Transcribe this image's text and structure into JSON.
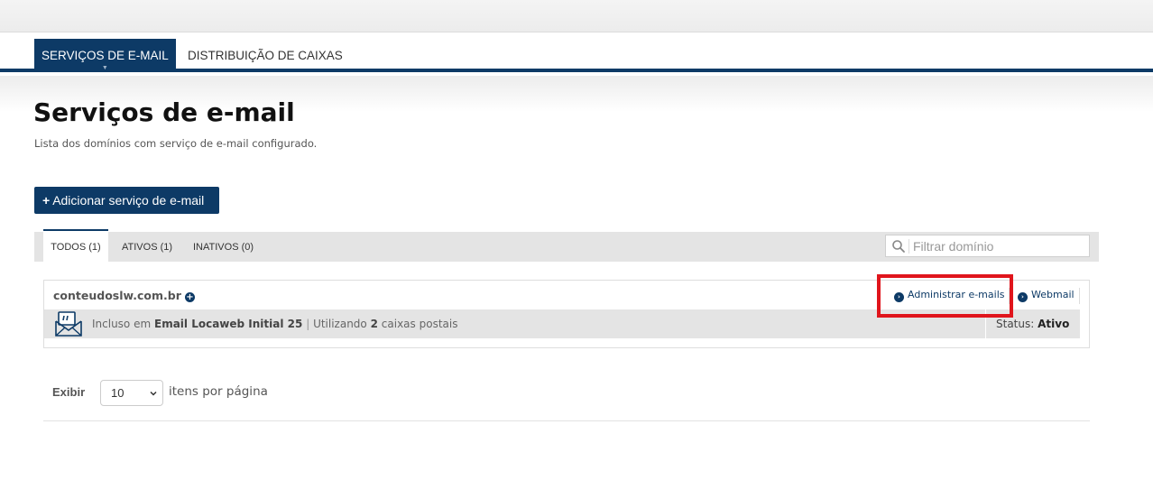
{
  "nav": {
    "tabs": [
      {
        "label": "SERVIÇOS DE E-MAIL",
        "active": true
      },
      {
        "label": "DISTRIBUIÇÃO DE CAIXAS",
        "active": false
      }
    ]
  },
  "page": {
    "title": "Serviços de e-mail",
    "subtitle": "Lista dos domínios com serviço de e-mail configurado.",
    "add_button_label": "Adicionar serviço de e-mail"
  },
  "filters": {
    "tabs": [
      {
        "label": "TODOS (1)",
        "active": true
      },
      {
        "label": "ATIVOS (1)",
        "active": false
      },
      {
        "label": "INATIVOS (0)",
        "active": false
      }
    ],
    "search_placeholder": "Filtrar domínio"
  },
  "domains": [
    {
      "name": "conteudoslw.com.br",
      "included_prefix": "Incluso em",
      "plan": "Email Locaweb Initial 25",
      "separator": "|",
      "using_prefix": "Utilizando",
      "mailbox_count": "2",
      "mailbox_suffix": "caixas postais",
      "status_label": "Status:",
      "status_value": "Ativo",
      "actions": {
        "admin_label": "Administrar e-mails",
        "webmail_label": "Webmail"
      }
    }
  ],
  "pagination": {
    "show_label": "Exibir",
    "per_page_value": "10",
    "per_page_suffix": "itens por página"
  },
  "colors": {
    "brand": "#0d3a66",
    "highlight": "#e0151c"
  },
  "icons": {
    "search": "search-icon",
    "mail": "open-envelope-icon",
    "chevron": "chevron-down-icon"
  }
}
